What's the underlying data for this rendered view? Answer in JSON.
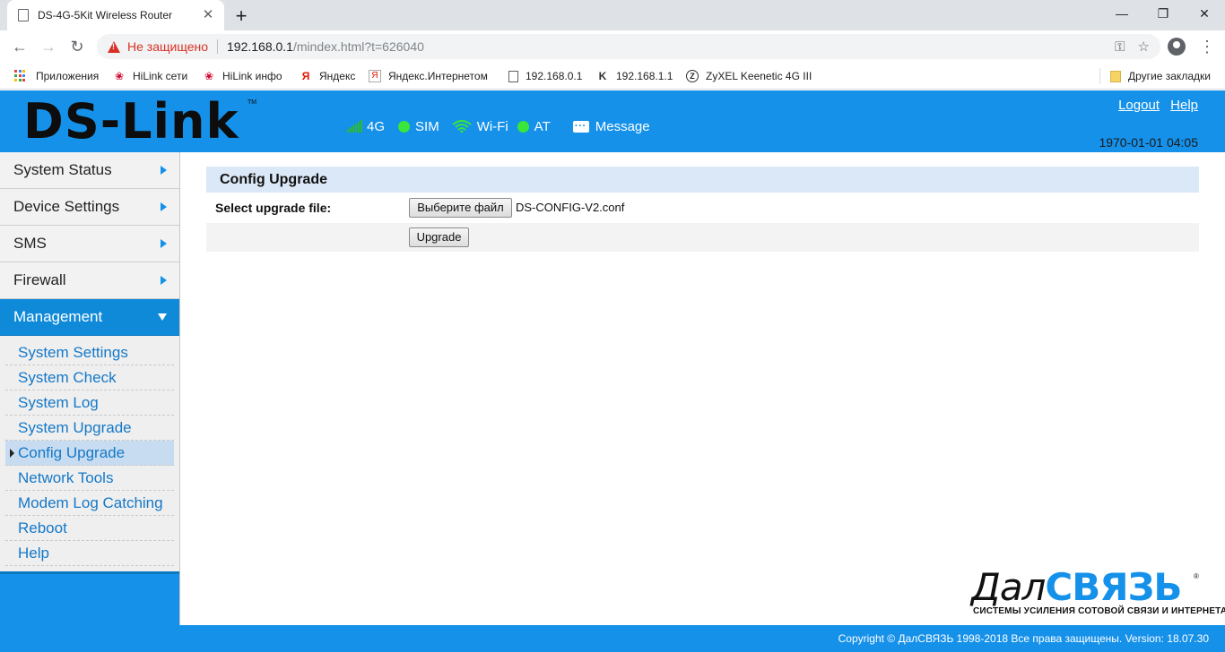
{
  "browser": {
    "tab_title": "DS-4G-5Kit Wireless Router",
    "tab_close": "✕",
    "new_tab": "+",
    "security_warning": "Не защищено",
    "url_host": "192.168.0.1",
    "url_path": "/mindex.html?t=626040",
    "bookmarks": [
      {
        "label": "Приложения",
        "icon": "apps-grid-icon"
      },
      {
        "label": "HiLink сети",
        "icon": "huawei-icon"
      },
      {
        "label": "HiLink инфо",
        "icon": "huawei-icon"
      },
      {
        "label": "Яндекс",
        "icon": "yandex-icon"
      },
      {
        "label": "Яндекс.Интернетом",
        "icon": "yandex-internetometr-icon"
      },
      {
        "label": "192.168.0.1",
        "icon": "page-icon"
      },
      {
        "label": "192.168.1.1",
        "icon": "keenetic-icon"
      },
      {
        "label": "ZyXEL Keenetic 4G III",
        "icon": "zyxel-icon"
      }
    ],
    "other_bookmarks": "Другие закладки"
  },
  "header": {
    "logo": "DS-Link",
    "logo_tm": "TM",
    "status": {
      "network": "4G",
      "sim": "SIM",
      "wifi": "Wi-Fi",
      "at": "AT",
      "message": "Message"
    },
    "logout": "Logout",
    "help": "Help",
    "datetime": "1970-01-01 04:05",
    "colors": {
      "header_bg": "#1591ea",
      "status_ok": "#39e639"
    }
  },
  "sidebar": {
    "menu": [
      {
        "label": "System Status",
        "expanded": false
      },
      {
        "label": "Device Settings",
        "expanded": false
      },
      {
        "label": "SMS",
        "expanded": false
      },
      {
        "label": "Firewall",
        "expanded": false
      },
      {
        "label": "Management",
        "expanded": true
      }
    ],
    "submenu": [
      "System Settings",
      "System Check",
      "System Log",
      "System Upgrade",
      "Config Upgrade",
      "Network Tools",
      "Modem Log Catching",
      "Reboot",
      "Help"
    ],
    "selected": "Config Upgrade"
  },
  "main": {
    "title": "Config Upgrade",
    "select_label": "Select upgrade file:",
    "choose_file_button": "Выберите файл",
    "file_name": "DS-CONFIG-V2.conf",
    "upgrade_button": "Upgrade"
  },
  "brand": {
    "word_part1": "Дал",
    "word_part2": "СВЯЗЬ",
    "reg": "®",
    "tagline": "СИСТЕМЫ УСИЛЕНИЯ СОТОВОЙ СВЯЗИ И ИНТЕРНЕТА"
  },
  "footer": {
    "text": "Copyright © ДалСВЯЗЬ 1998-2018 Все права защищены. Version: 18.07.30"
  }
}
